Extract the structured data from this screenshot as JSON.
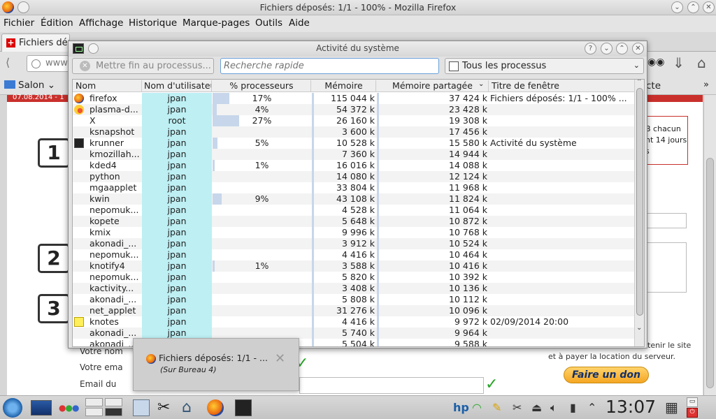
{
  "firefox": {
    "window_title": "Fichiers déposés: 1/1 - 100% - Mozilla Firefox",
    "menu": [
      "Fichier",
      "Édition",
      "Affichage",
      "Historique",
      "Marque-pages",
      "Outils",
      "Aide"
    ],
    "tab_label": "Fichiers dépos",
    "url_fragment": "www.",
    "bookmarks": {
      "folder": "Salon",
      "right_fragment": "cte"
    },
    "page": {
      "date_fragment": "07.08.2014 - 1",
      "steps": [
        "1",
        "2",
        "3"
      ],
      "side_text": [
        "B chacun",
        "nt 14 jours",
        "s"
      ],
      "form_labels": [
        "Votre nom",
        "Votre ema",
        "Email du"
      ],
      "support_text": [
        "tenir le site",
        "et à payer la location du serveur."
      ],
      "donate_label": "Faire un don"
    }
  },
  "sysact": {
    "title": "Activité du système",
    "kill_label": "Mettre fin au processus...",
    "search_placeholder": "Recherche rapide",
    "filter_selected": "Tous les processus",
    "columns": [
      "Nom",
      "Nom d'utilisateur",
      "% processeurs",
      "Mémoire",
      "Mémoire partagée",
      "Titre de fenêtre"
    ],
    "processes": [
      {
        "icon": "firefox-icon",
        "name": "firefox",
        "user": "jpan",
        "cpu": "17%",
        "cpu_pct": 17,
        "mem": "115 044 k",
        "shared": "37 424 k",
        "title": "Fichiers déposés: 1/1 - 100% ..."
      },
      {
        "icon": "plasma-icon",
        "name": "plasma-d...",
        "user": "jpan",
        "cpu": "4%",
        "cpu_pct": 4,
        "mem": "54 372 k",
        "shared": "23 428 k",
        "title": ""
      },
      {
        "icon": "",
        "name": "X",
        "user": "root",
        "cpu": "27%",
        "cpu_pct": 27,
        "mem": "26 160 k",
        "shared": "19 308 k",
        "title": ""
      },
      {
        "icon": "",
        "name": "ksnapshot",
        "user": "jpan",
        "cpu": "",
        "cpu_pct": 0,
        "mem": "3 600 k",
        "shared": "17 456 k",
        "title": ""
      },
      {
        "icon": "terminal-icon",
        "name": "krunner",
        "user": "jpan",
        "cpu": "5%",
        "cpu_pct": 5,
        "mem": "10 528 k",
        "shared": "15 580 k",
        "title": "Activité du système"
      },
      {
        "icon": "",
        "name": "kmozillah...",
        "user": "jpan",
        "cpu": "",
        "cpu_pct": 0,
        "mem": "7 360 k",
        "shared": "14 944 k",
        "title": ""
      },
      {
        "icon": "",
        "name": "kded4",
        "user": "jpan",
        "cpu": "1%",
        "cpu_pct": 1,
        "mem": "16 016 k",
        "shared": "14 088 k",
        "title": ""
      },
      {
        "icon": "",
        "name": "python",
        "user": "jpan",
        "cpu": "",
        "cpu_pct": 0,
        "mem": "14 080 k",
        "shared": "12 124 k",
        "title": ""
      },
      {
        "icon": "",
        "name": "mgaapplet",
        "user": "jpan",
        "cpu": "",
        "cpu_pct": 0,
        "mem": "33 804 k",
        "shared": "11 968 k",
        "title": ""
      },
      {
        "icon": "",
        "name": "kwin",
        "user": "jpan",
        "cpu": "9%",
        "cpu_pct": 9,
        "mem": "43 108 k",
        "shared": "11 824 k",
        "title": ""
      },
      {
        "icon": "",
        "name": "nepomuk...",
        "user": "jpan",
        "cpu": "",
        "cpu_pct": 0,
        "mem": "4 528 k",
        "shared": "11 064 k",
        "title": ""
      },
      {
        "icon": "",
        "name": "kopete",
        "user": "jpan",
        "cpu": "",
        "cpu_pct": 0,
        "mem": "5 648 k",
        "shared": "10 872 k",
        "title": ""
      },
      {
        "icon": "",
        "name": "kmix",
        "user": "jpan",
        "cpu": "",
        "cpu_pct": 0,
        "mem": "9 996 k",
        "shared": "10 768 k",
        "title": ""
      },
      {
        "icon": "",
        "name": "akonadi_...",
        "user": "jpan",
        "cpu": "",
        "cpu_pct": 0,
        "mem": "3 912 k",
        "shared": "10 524 k",
        "title": ""
      },
      {
        "icon": "",
        "name": "nepomuk...",
        "user": "jpan",
        "cpu": "",
        "cpu_pct": 0,
        "mem": "4 416 k",
        "shared": "10 464 k",
        "title": ""
      },
      {
        "icon": "",
        "name": "knotify4",
        "user": "jpan",
        "cpu": "1%",
        "cpu_pct": 1,
        "mem": "3 588 k",
        "shared": "10 416 k",
        "title": ""
      },
      {
        "icon": "",
        "name": "nepomuk...",
        "user": "jpan",
        "cpu": "",
        "cpu_pct": 0,
        "mem": "5 820 k",
        "shared": "10 392 k",
        "title": ""
      },
      {
        "icon": "",
        "name": "kactivity...",
        "user": "jpan",
        "cpu": "",
        "cpu_pct": 0,
        "mem": "3 408 k",
        "shared": "10 136 k",
        "title": ""
      },
      {
        "icon": "",
        "name": "akonadi_...",
        "user": "jpan",
        "cpu": "",
        "cpu_pct": 0,
        "mem": "5 808 k",
        "shared": "10 112 k",
        "title": ""
      },
      {
        "icon": "",
        "name": "net_applet",
        "user": "jpan",
        "cpu": "",
        "cpu_pct": 0,
        "mem": "31 276 k",
        "shared": "10 096 k",
        "title": ""
      },
      {
        "icon": "knotes-icon",
        "name": "knotes",
        "user": "jpan",
        "cpu": "",
        "cpu_pct": 0,
        "mem": "4 416 k",
        "shared": "9 972 k",
        "title": "02/09/2014 20:00"
      },
      {
        "icon": "",
        "name": "akonadi_...",
        "user": "jpan",
        "cpu": "",
        "cpu_pct": 0,
        "mem": "5 740 k",
        "shared": "9 964 k",
        "title": ""
      },
      {
        "icon": "",
        "name": "akonadi_...",
        "user": "jpan",
        "cpu": "",
        "cpu_pct": 0,
        "mem": "5 504 k",
        "shared": "9 588 k",
        "title": ""
      }
    ]
  },
  "notification": {
    "title": "Fichiers déposés: 1/1 - ...",
    "subtitle": "(Sur Bureau 4)"
  },
  "taskbar": {
    "clock": "13:07"
  }
}
